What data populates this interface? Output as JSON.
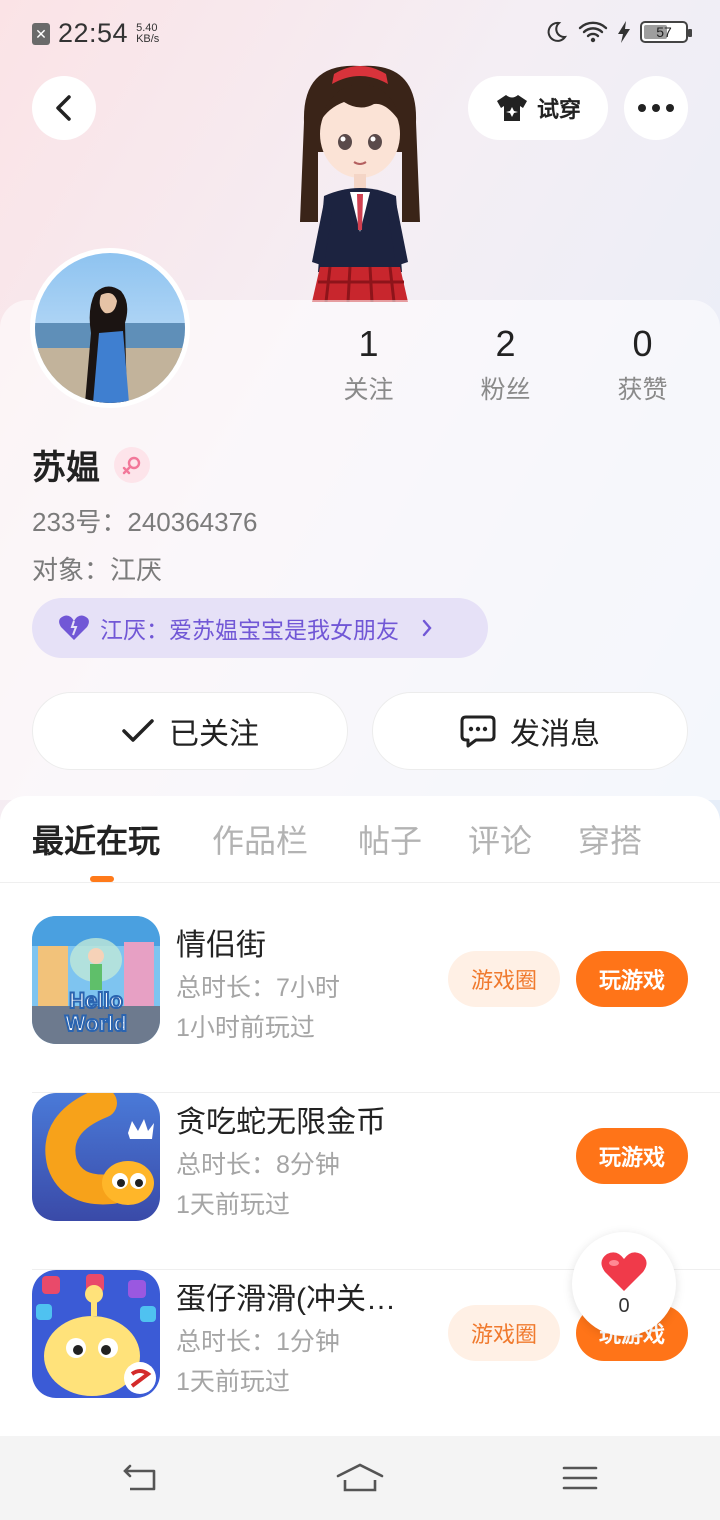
{
  "status_bar": {
    "time": "22:54",
    "speed_value": "5.40",
    "speed_unit": "KB/s",
    "battery": "57",
    "battery_level": 0.57
  },
  "header": {
    "tryon_label": "试穿"
  },
  "profile": {
    "name": "苏媪",
    "id_line": "233号：240364376",
    "partner_line": "对象：江厌",
    "love_message": "江厌：爱苏媪宝宝是我女朋友"
  },
  "stats": [
    {
      "value": "1",
      "label": "关注"
    },
    {
      "value": "2",
      "label": "粉丝"
    },
    {
      "value": "0",
      "label": "获赞"
    }
  ],
  "actions": {
    "followed_label": "已关注",
    "message_label": "发消息"
  },
  "tabs": [
    "最近在玩",
    "作品栏",
    "帖子",
    "评论",
    "穿搭"
  ],
  "games": [
    {
      "title": "情侣街",
      "duration": "总时长：7小时",
      "last_played": "1小时前玩过",
      "circle_label": "游戏圈",
      "play_label": "玩游戏",
      "icon_text_1": "Hello",
      "icon_text_2": "World"
    },
    {
      "title": "贪吃蛇无限金币",
      "duration": "总时长：8分钟",
      "last_played": "1天前玩过",
      "play_label": "玩游戏"
    },
    {
      "title": "蛋仔滑滑(冲关…",
      "duration": "总时长：1分钟",
      "last_played": "1天前玩过",
      "circle_label": "游戏圈",
      "play_label": "玩游戏"
    }
  ],
  "floating_like": {
    "count": "0"
  }
}
